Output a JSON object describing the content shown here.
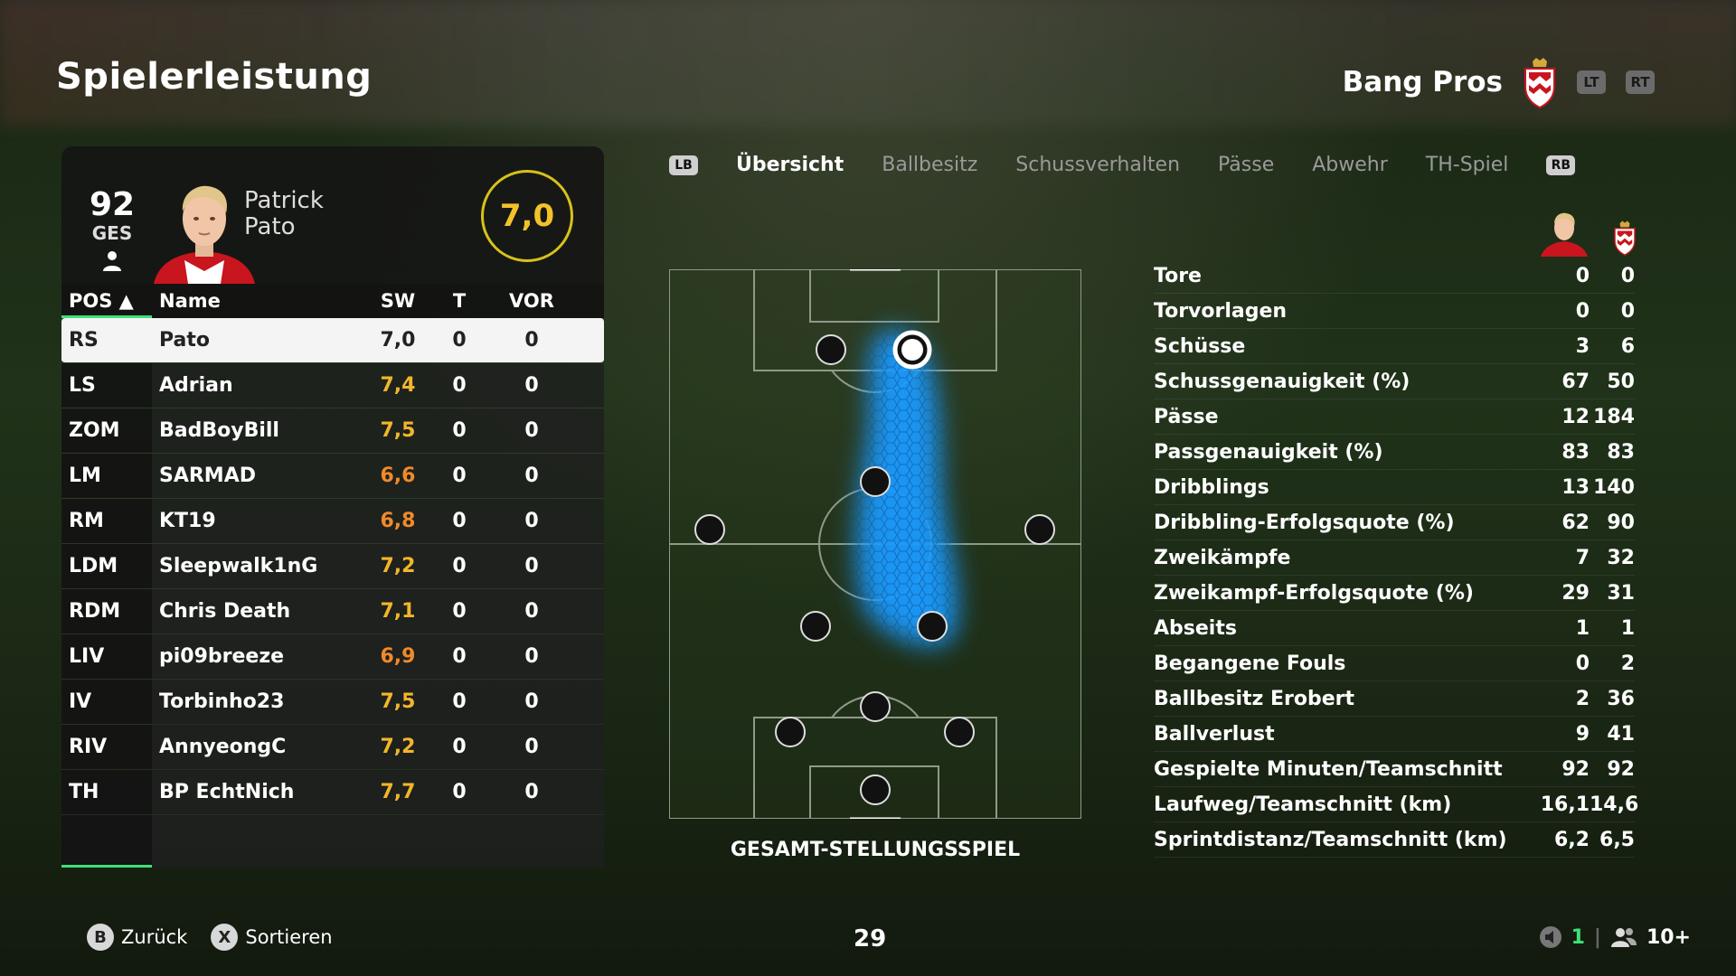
{
  "header": {
    "title": "Spielerleistung",
    "team_name": "Bang Pros",
    "lt_label": "LT",
    "rt_label": "RT"
  },
  "player_card": {
    "overall": "92",
    "overall_label": "GES",
    "first_name": "Patrick",
    "last_name": "Pato",
    "rating": "7,0"
  },
  "table": {
    "headers": {
      "pos": "POS ▲",
      "name": "Name",
      "sw": "SW",
      "t": "T",
      "vor": "VOR"
    },
    "rows": [
      {
        "pos": "RS",
        "name": "Pato",
        "sw": "7,0",
        "t": "0",
        "vor": "0"
      },
      {
        "pos": "LS",
        "name": "Adrian",
        "sw": "7,4",
        "t": "0",
        "vor": "0"
      },
      {
        "pos": "ZOM",
        "name": "BadBoyBill",
        "sw": "7,5",
        "t": "0",
        "vor": "0"
      },
      {
        "pos": "LM",
        "name": "SARMAD",
        "sw": "6,6",
        "t": "0",
        "vor": "0"
      },
      {
        "pos": "RM",
        "name": "KT19",
        "sw": "6,8",
        "t": "0",
        "vor": "0"
      },
      {
        "pos": "LDM",
        "name": "Sleepwalk1nG",
        "sw": "7,2",
        "t": "0",
        "vor": "0"
      },
      {
        "pos": "RDM",
        "name": "Chris Death",
        "sw": "7,1",
        "t": "0",
        "vor": "0"
      },
      {
        "pos": "LIV",
        "name": "pi09breeze",
        "sw": "6,9",
        "t": "0",
        "vor": "0"
      },
      {
        "pos": "IV",
        "name": "Torbinho23",
        "sw": "7,5",
        "t": "0",
        "vor": "0"
      },
      {
        "pos": "RIV",
        "name": "AnnyeongC",
        "sw": "7,2",
        "t": "0",
        "vor": "0"
      },
      {
        "pos": "TH",
        "name": "BP EchtNich",
        "sw": "7,7",
        "t": "0",
        "vor": "0"
      }
    ]
  },
  "tabs": {
    "lb": "LB",
    "rb": "RB",
    "items": [
      "Übersicht",
      "Ballbesitz",
      "Schussverhalten",
      "Pässe",
      "Abwehr",
      "TH-Spiel"
    ]
  },
  "pitch": {
    "caption": "GESAMT-STELLUNGSSPIEL"
  },
  "stats": [
    {
      "label": "Tore",
      "player": "0",
      "team": "0"
    },
    {
      "label": "Torvorlagen",
      "player": "0",
      "team": "0"
    },
    {
      "label": "Schüsse",
      "player": "3",
      "team": "6"
    },
    {
      "label": "Schussgenauigkeit (%)",
      "player": "67",
      "team": "50"
    },
    {
      "label": "Pässe",
      "player": "12",
      "team": "184"
    },
    {
      "label": "Passgenauigkeit (%)",
      "player": "83",
      "team": "83"
    },
    {
      "label": "Dribblings",
      "player": "13",
      "team": "140"
    },
    {
      "label": "Dribbling-Erfolgsquote (%)",
      "player": "62",
      "team": "90"
    },
    {
      "label": "Zweikämpfe",
      "player": "7",
      "team": "32"
    },
    {
      "label": "Zweikampf-Erfolgsquote (%)",
      "player": "29",
      "team": "31"
    },
    {
      "label": "Abseits",
      "player": "1",
      "team": "1"
    },
    {
      "label": "Begangene Fouls",
      "player": "0",
      "team": "2"
    },
    {
      "label": "Ballbesitz Erobert",
      "player": "2",
      "team": "36"
    },
    {
      "label": "Ballverlust",
      "player": "9",
      "team": "41"
    },
    {
      "label": "Gespielte Minuten/Teamschnitt",
      "player": "92",
      "team": "92"
    },
    {
      "label": "Laufweg/Teamschnitt (km)",
      "player": "16,1",
      "team": "14,6"
    },
    {
      "label": "Sprintdistanz/Teamschnitt (km)",
      "player": "6,2",
      "team": "6,5"
    }
  ],
  "footer": {
    "back_key": "B",
    "back_label": "Zurück",
    "sort_key": "X",
    "sort_label": "Sortieren",
    "page": "29",
    "mic_count": "1",
    "party_count": "10+"
  },
  "colors": {
    "rating_gold": "#f2b62b",
    "rating_orange": "#f08a2a",
    "accent_green": "#3ee07a",
    "heatmap_blue": "#1a9bff"
  }
}
